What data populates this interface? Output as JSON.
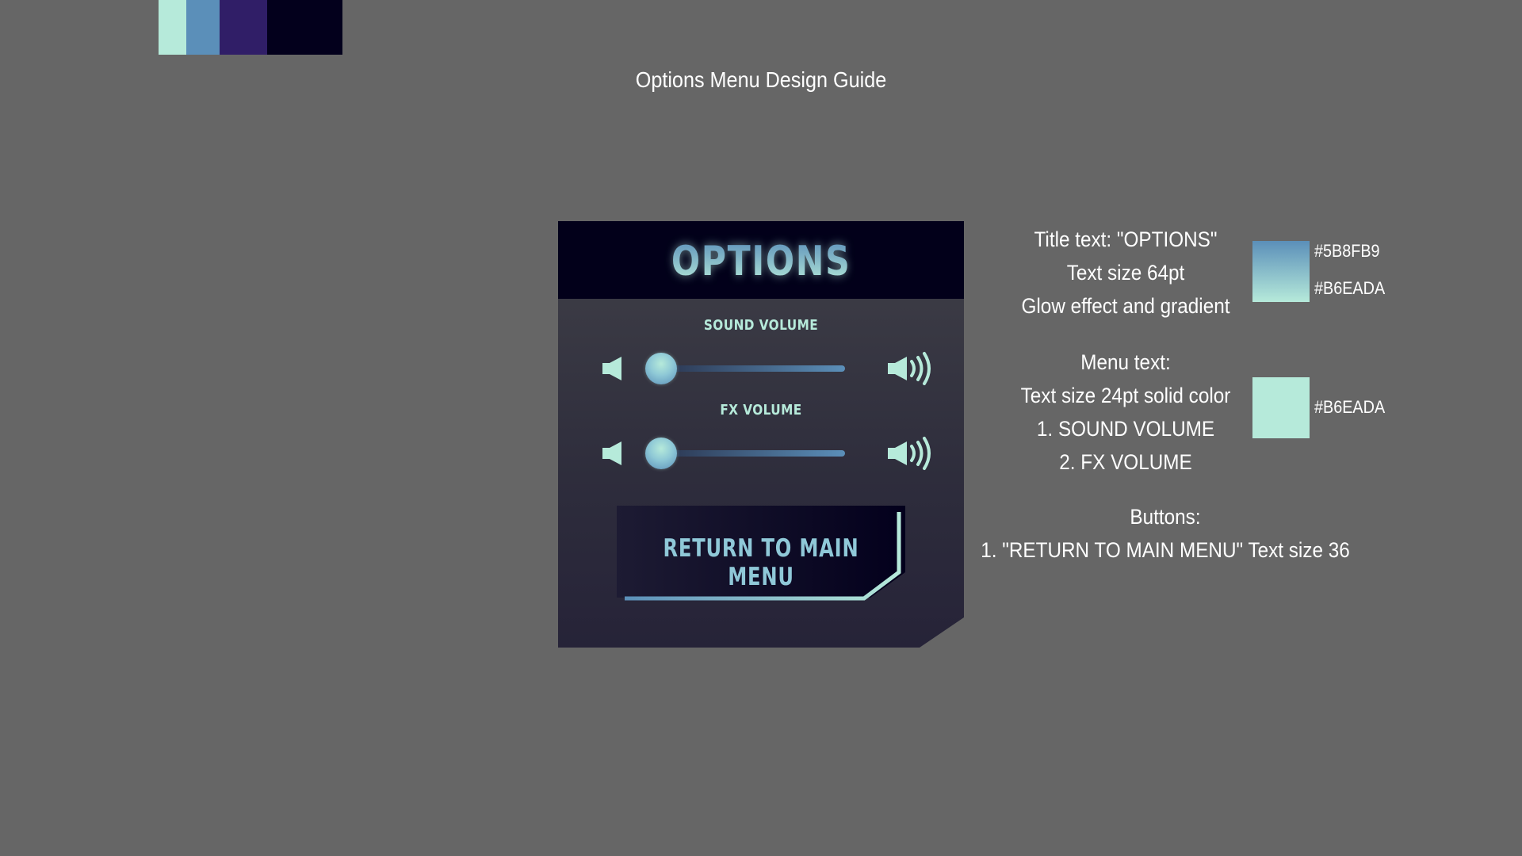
{
  "page": {
    "title": "Options Menu Design Guide"
  },
  "palette": {
    "colors": [
      "#b6eada",
      "#5b8fb9",
      "#301e67",
      "#03001c"
    ]
  },
  "options_panel": {
    "title": "OPTIONS",
    "sound_volume": {
      "label": "SOUND VOLUME",
      "level": 0.0,
      "icons": [
        "volume-low-icon",
        "volume-high-icon"
      ]
    },
    "fx_volume": {
      "label": "FX VOLUME",
      "level": 0.0,
      "icons": [
        "volume-low-icon",
        "volume-high-icon"
      ]
    },
    "return_button": {
      "label": "RETURN TO MAIN MENU"
    }
  },
  "annotations": {
    "title_spec": {
      "lines": [
        "Title text: \"OPTIONS\"",
        "Text size 64pt",
        "Glow effect and gradient"
      ],
      "gradient_top": "#5B8FB9",
      "gradient_bottom": "#B6EADA"
    },
    "menu_spec": {
      "lines": [
        "Menu text:",
        "Text size 24pt solid color",
        "1. SOUND VOLUME",
        "2. FX VOLUME"
      ],
      "color": "#B6EADA"
    },
    "buttons_spec": {
      "lines": [
        "Buttons:",
        "1. \"RETURN TO MAIN MENU\" Text size 36"
      ]
    }
  },
  "colors": {
    "background": "#666666",
    "accent_light": "#b6eada",
    "accent_blue": "#5b8fb9",
    "header_dark": "#02001a"
  }
}
